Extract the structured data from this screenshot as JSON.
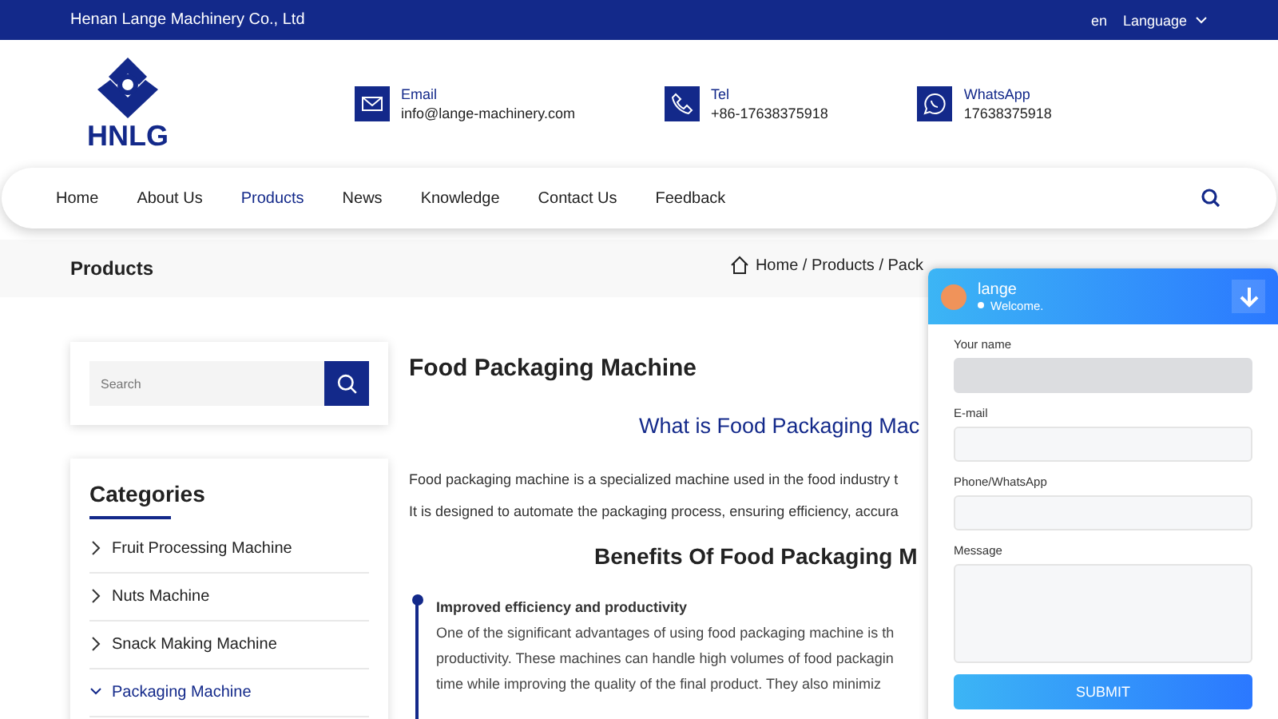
{
  "topbar": {
    "company": "Henan Lange Machinery Co., Ltd",
    "lang_code": "en",
    "language": "Language"
  },
  "logo": {
    "text": "HNLG"
  },
  "contacts": [
    {
      "kind": "email",
      "label": "Email",
      "value": "info@lange-machinery.com"
    },
    {
      "kind": "phone",
      "label": "Tel",
      "value": "+86-17638375918"
    },
    {
      "kind": "whatsapp",
      "label": "WhatsApp",
      "value": "17638375918"
    }
  ],
  "nav": [
    {
      "label": "Home",
      "selected": false
    },
    {
      "label": "About Us",
      "selected": false
    },
    {
      "label": "Products",
      "selected": true
    },
    {
      "label": "News",
      "selected": false
    },
    {
      "label": "Knowledge",
      "selected": false
    },
    {
      "label": "Contact Us",
      "selected": false
    },
    {
      "label": "Feedback",
      "selected": false
    }
  ],
  "page_title": "Products",
  "breadcrumb": "Home / Products / Pack",
  "search": {
    "placeholder": "Search"
  },
  "categories": {
    "title": "Categories",
    "items": [
      {
        "label": "Fruit Processing Machine",
        "expanded": false
      },
      {
        "label": "Nuts Machine",
        "expanded": false
      },
      {
        "label": "Snack Making Machine",
        "expanded": false
      },
      {
        "label": "Packaging Machine",
        "expanded": true
      }
    ]
  },
  "article": {
    "title": "Food Packaging Machine",
    "subtitle": "What is Food Packaging Mac",
    "intro_lines": [
      "Food packaging machine is a specialized machine used in the food industry t",
      "It is designed to automate the packaging process, ensuring efficiency, accura"
    ],
    "benefits_title": "Benefits Of Food Packaging M",
    "benefits": [
      {
        "title": "Improved efficiency and productivity",
        "lines": [
          "One of the significant advantages of using food packaging machine is th",
          "productivity. These machines can handle high volumes of food packagin",
          "time while improving the quality of the final product. They also minimiz"
        ]
      }
    ]
  },
  "chat": {
    "agent": "lange",
    "status": "Welcome.",
    "fields": [
      {
        "label": "Your name",
        "kind": "input",
        "disabled": true
      },
      {
        "label": "E-mail",
        "kind": "input",
        "disabled": false
      },
      {
        "label": "Phone/WhatsApp",
        "kind": "input",
        "disabled": false
      },
      {
        "label": "Message",
        "kind": "textarea",
        "disabled": false
      }
    ],
    "submit": "SUBMIT"
  }
}
